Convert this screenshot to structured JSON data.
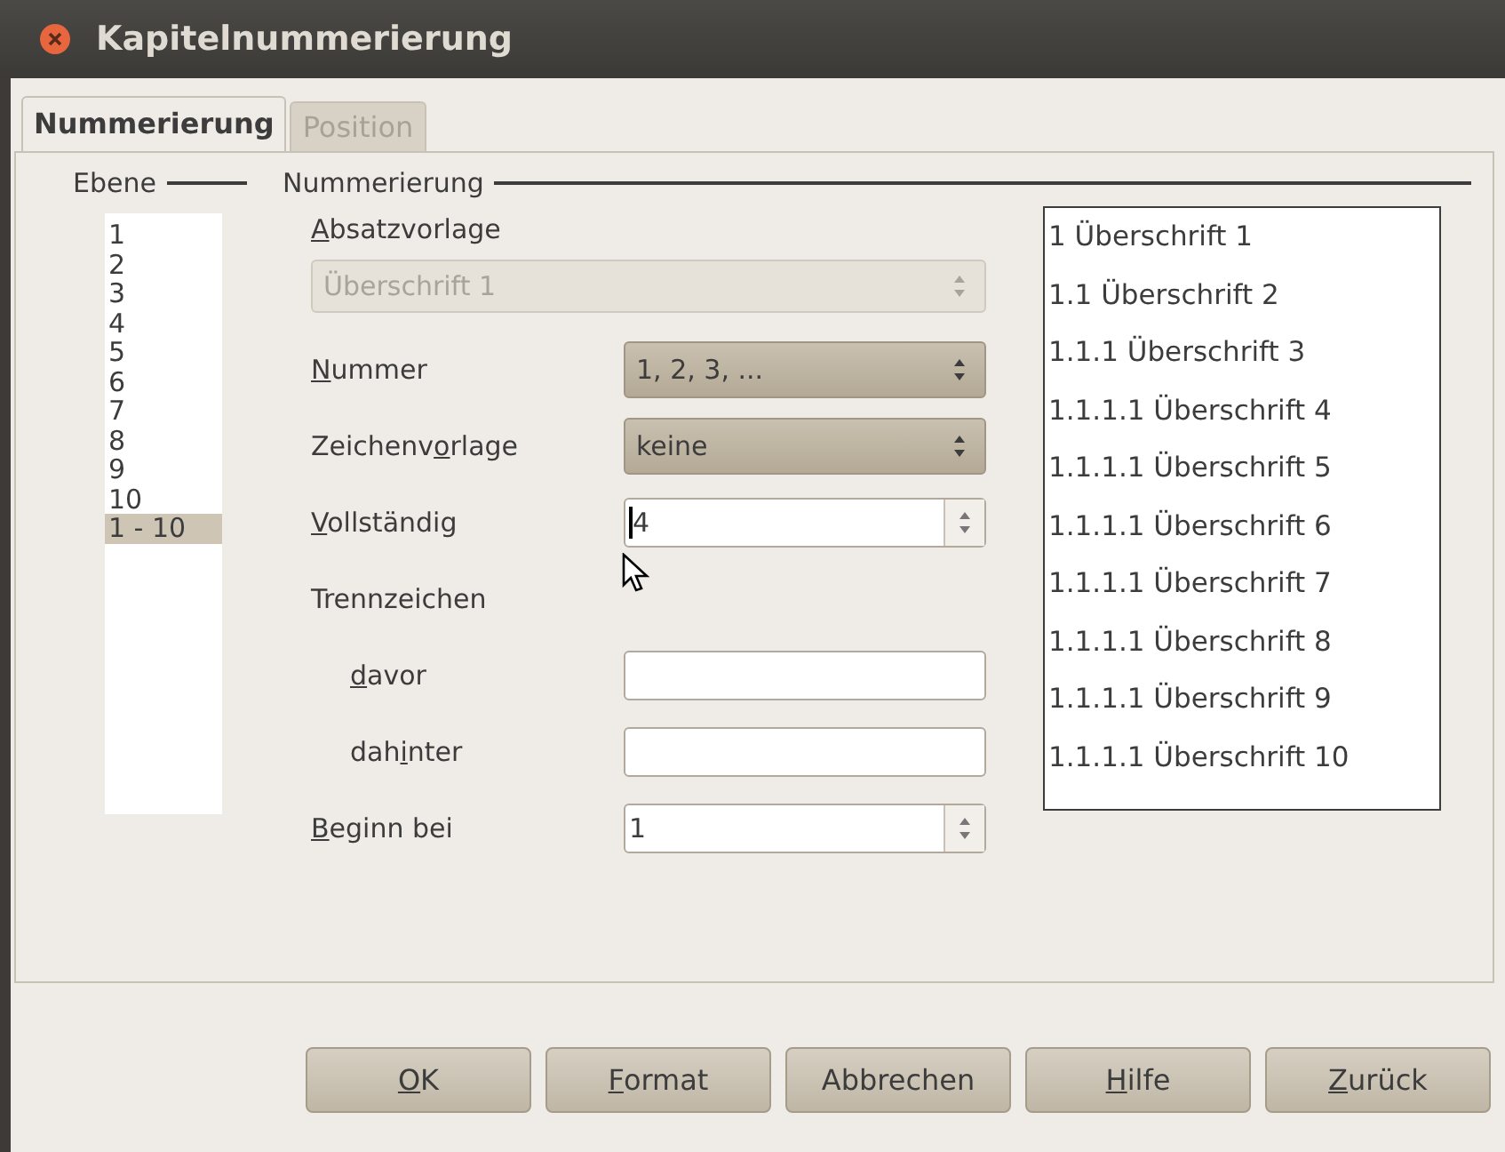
{
  "window": {
    "title": "Kapitelnummerierung"
  },
  "tabs": [
    {
      "label": "Nummerierung",
      "selected": true
    },
    {
      "label": "Position",
      "selected": false
    }
  ],
  "level_group": {
    "title": "Ebene",
    "items": [
      {
        "label": "1",
        "selected": false
      },
      {
        "label": "2",
        "selected": false
      },
      {
        "label": "3",
        "selected": false
      },
      {
        "label": "4",
        "selected": false
      },
      {
        "label": "5",
        "selected": false
      },
      {
        "label": "6",
        "selected": false
      },
      {
        "label": "7",
        "selected": false
      },
      {
        "label": "8",
        "selected": false
      },
      {
        "label": "9",
        "selected": false
      },
      {
        "label": "10",
        "selected": false
      },
      {
        "label": "1 - 10",
        "selected": true
      }
    ]
  },
  "numbering_group": {
    "title": "Nummerierung",
    "paragraph_style": {
      "label": {
        "key": "A",
        "post": "bsatzvorlage"
      },
      "value": "Überschrift 1",
      "disabled": true
    },
    "fields": [
      {
        "kind": "combo",
        "label": {
          "key": "N",
          "post": "ummer"
        },
        "value": "1, 2, 3, ..."
      },
      {
        "kind": "combo",
        "label": {
          "pre": "Zeichenv",
          "key": "o",
          "post": "rlage"
        },
        "value": "keine"
      },
      {
        "kind": "spin",
        "label": {
          "key": "V",
          "post": "ollständig"
        },
        "value": "4",
        "focused": true
      },
      {
        "kind": "heading",
        "label": {
          "pre": "Trennzeichen"
        }
      },
      {
        "kind": "text",
        "label": {
          "key": "d",
          "post": "avor"
        }
      },
      {
        "kind": "text",
        "label": {
          "pre": "dah",
          "key": "i",
          "post": "nter"
        }
      },
      {
        "kind": "spin",
        "label": {
          "key": "B",
          "post": "eginn bei"
        },
        "value": "1"
      }
    ]
  },
  "preview": [
    "1 Überschrift 1",
    "1.1 Überschrift 2",
    "1.1.1 Überschrift 3",
    "1.1.1.1 Überschrift 4",
    "1.1.1.1 Überschrift 5",
    "1.1.1.1 Überschrift 6",
    "1.1.1.1 Überschrift 7",
    "1.1.1.1 Überschrift 8",
    "1.1.1.1 Überschrift 9",
    "1.1.1.1 Überschrift 10"
  ],
  "buttons": [
    {
      "key": "O",
      "post": "K"
    },
    {
      "key": "F",
      "post": "ormat"
    },
    {
      "pre": "Abbrechen"
    },
    {
      "key": "H",
      "post": "ilfe"
    },
    {
      "key": "Z",
      "post": "urück"
    }
  ]
}
